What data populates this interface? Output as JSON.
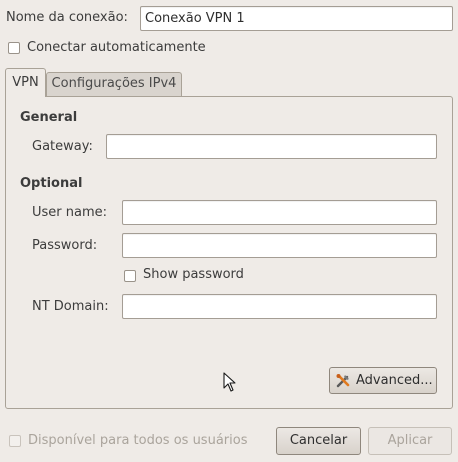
{
  "connection": {
    "name_label": "Nome da conexão:",
    "name_value": "Conexão VPN 1",
    "auto_connect_label": "Conectar automaticamente"
  },
  "tabs": [
    {
      "label": "VPN",
      "active": true
    },
    {
      "label": "Configurações IPv4",
      "active": false
    }
  ],
  "vpn": {
    "general_heading": "General",
    "gateway_label": "Gateway:",
    "gateway_value": "",
    "optional_heading": "Optional",
    "username_label": "User name:",
    "username_value": "",
    "password_label": "Password:",
    "password_value": "",
    "show_password_label": "Show password",
    "ntdomain_label": "NT Domain:",
    "ntdomain_value": "",
    "advanced_label": "Advanced..."
  },
  "footer": {
    "all_users_label": "Disponível para todos os usuários",
    "cancel_label": "Cancelar",
    "apply_label": "Aplicar"
  },
  "icons": {
    "advanced": "tools-icon",
    "cursor": "mouse-pointer-icon"
  }
}
